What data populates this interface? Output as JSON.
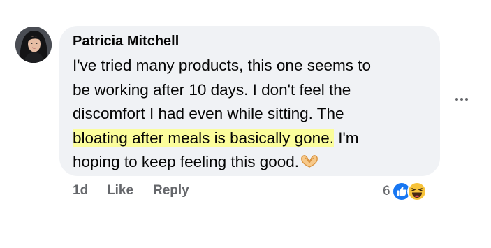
{
  "comment": {
    "author": "Patricia Mitchell",
    "lines": [
      "I've tried many products, this one seems to",
      "be working after 10 days. I don't feel the",
      "discomfort I had even while sitting. The"
    ],
    "highlighted_text": "bloating after meals is basically gone.",
    "line4_rest": " I'm",
    "line5": "hoping to keep feeling this good.",
    "emoji": "heart-hands",
    "highlight_color": "#fbfd9c",
    "bubble_color": "#f0f2f5"
  },
  "actions": {
    "time": "1d",
    "like": "Like",
    "reply": "Reply"
  },
  "reactions": {
    "count": "6",
    "types": [
      "like-icon",
      "haha-icon"
    ],
    "like_color": "#1877f2"
  },
  "more_options_icon": "more-horizontal-icon"
}
